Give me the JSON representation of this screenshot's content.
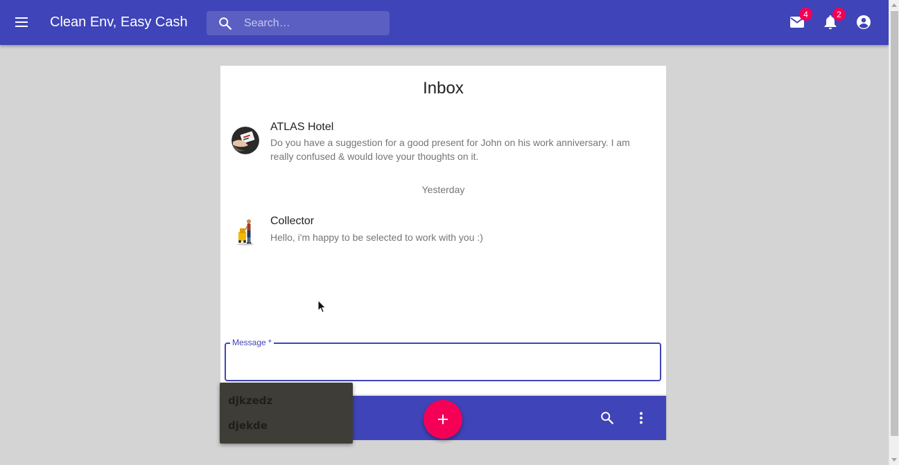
{
  "app": {
    "title": "Clean Env, Easy Cash",
    "accent_color": "#3f44b8",
    "badge_color": "#f50057"
  },
  "header": {
    "menu_icon": "menu-icon",
    "search": {
      "placeholder": "Search…",
      "value": "",
      "icon": "search-icon"
    },
    "mail": {
      "icon": "mail-icon",
      "badge": "4"
    },
    "notifications": {
      "icon": "bell-icon",
      "badge": "2"
    },
    "account": {
      "icon": "account-circle-icon"
    }
  },
  "inbox": {
    "title": "Inbox",
    "messages": [
      {
        "sender": "ATLAS Hotel",
        "text": "Do you have a suggestion for a good present for John on his work anniversary. I am really confused & would love your thoughts on it.",
        "avatar": "hotel-avatar"
      },
      {
        "sender": "Collector",
        "text": "Hello, i'm happy to be selected to work with you :)",
        "avatar": "collector-avatar"
      }
    ],
    "day_separator": "Yesterday"
  },
  "message_field": {
    "label": "Message *",
    "value": ""
  },
  "bottom_bar": {
    "fab_icon": "add-icon",
    "search_icon": "search-icon",
    "more_icon": "more-vert-icon"
  },
  "autocomplete": {
    "items": [
      "djkzedz",
      "djekde"
    ]
  }
}
